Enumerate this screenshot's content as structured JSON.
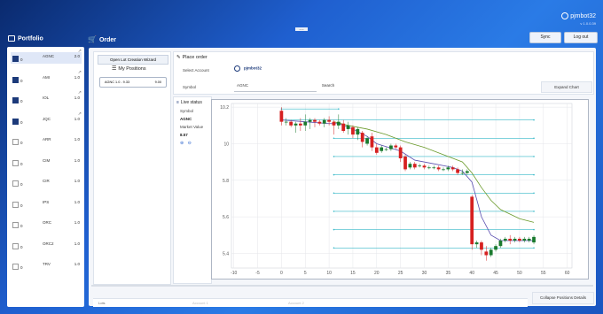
{
  "window": {
    "title_badge": "~~~"
  },
  "user": {
    "name": "pjmbot32",
    "version": "v 1.0.0.39"
  },
  "header": {
    "portfolio_title": "Portfolio",
    "order_title": "Order",
    "sync_label": "Sync",
    "logout_label": "Log out"
  },
  "portfolio": {
    "rows": [
      {
        "checked": true,
        "qty": "0",
        "symbol": "AGNC",
        "value": "2.0",
        "selected": true,
        "marked": true
      },
      {
        "checked": true,
        "qty": "0",
        "symbol": "AMI",
        "value": "1.0",
        "selected": false,
        "marked": true
      },
      {
        "checked": true,
        "qty": "0",
        "symbol": "IOL",
        "value": "1.0",
        "selected": false,
        "marked": true
      },
      {
        "checked": true,
        "qty": "0",
        "symbol": "JQC",
        "value": "1.0",
        "selected": false,
        "marked": true
      },
      {
        "checked": false,
        "qty": "0",
        "symbol": "ARR",
        "value": "1.0",
        "selected": false,
        "marked": false
      },
      {
        "checked": false,
        "qty": "0",
        "symbol": "CIM",
        "value": "1.0",
        "selected": false,
        "marked": false
      },
      {
        "checked": false,
        "qty": "0",
        "symbol": "CIR",
        "value": "1.0",
        "selected": false,
        "marked": false
      },
      {
        "checked": false,
        "qty": "0",
        "symbol": "IPS",
        "value": "1.0",
        "selected": false,
        "marked": false
      },
      {
        "checked": false,
        "qty": "0",
        "symbol": "ORC",
        "value": "1.0",
        "selected": false,
        "marked": false
      },
      {
        "checked": false,
        "qty": "0",
        "symbol": "ORC2",
        "value": "1.0",
        "selected": false,
        "marked": false
      },
      {
        "checked": false,
        "qty": "0",
        "symbol": "TRV",
        "value": "1.0",
        "selected": false,
        "marked": false
      }
    ]
  },
  "positions": {
    "wizard_label": "Open Lot Creation Wizard",
    "title": "My Positions",
    "item_symbol": "AGNC 1.0 - 9.33",
    "item_value": "9.00"
  },
  "place_order": {
    "title": "Place order",
    "account_label": "Select Account",
    "account_name": "pjmbot32",
    "symbol_label": "Symbol",
    "symbol_value": "AGNC",
    "search_label": "Search",
    "expand_label": "Expand Chart"
  },
  "live_status": {
    "title": "Live status",
    "symbol_label": "Symbol",
    "symbol_value": "AGNC",
    "market_value_label": "Market Value",
    "market_value": "8.57"
  },
  "bottom": {
    "collapse_label": "Collapse Positions Details",
    "lots_label": "Lots",
    "account1": "Account 1",
    "account2": "Account 2"
  },
  "colors": {
    "up": "#1a7a2e",
    "down": "#d62020",
    "ma_fast": "#5a4fb0",
    "ma_slow": "#6a9a2a",
    "level": "#35b8c8"
  },
  "chart_data": {
    "type": "candlestick",
    "xticks": [
      -10,
      -5,
      0,
      5,
      10,
      15,
      20,
      25,
      30,
      35,
      40,
      45,
      50,
      55,
      60
    ],
    "yticks": [
      5.4,
      5.6,
      5.8,
      10,
      10.2
    ],
    "ytick_values": [
      9.4,
      9.6,
      9.8,
      10.0,
      10.2
    ],
    "xlim": [
      -10.5,
      61
    ],
    "ylim": [
      9.32,
      10.22
    ],
    "candles": [
      {
        "x": 0,
        "o": 10.18,
        "c": 10.12,
        "h": 10.2,
        "l": 10.1
      },
      {
        "x": 1,
        "o": 10.12,
        "c": 10.12,
        "h": 10.14,
        "l": 10.1
      },
      {
        "x": 2,
        "o": 10.12,
        "c": 10.1,
        "h": 10.13,
        "l": 10.09
      },
      {
        "x": 3,
        "o": 10.1,
        "c": 10.11,
        "h": 10.12,
        "l": 10.06
      },
      {
        "x": 4,
        "o": 10.11,
        "c": 10.1,
        "h": 10.14,
        "l": 10.07
      },
      {
        "x": 5,
        "o": 10.1,
        "c": 10.12,
        "h": 10.16,
        "l": 10.07
      },
      {
        "x": 6,
        "o": 10.12,
        "c": 10.13,
        "h": 10.14,
        "l": 10.08
      },
      {
        "x": 7,
        "o": 10.13,
        "c": 10.12,
        "h": 10.14,
        "l": 10.09
      },
      {
        "x": 8,
        "o": 10.12,
        "c": 10.11,
        "h": 10.13,
        "l": 10.1
      },
      {
        "x": 9,
        "o": 10.11,
        "c": 10.13,
        "h": 10.14,
        "l": 10.09
      },
      {
        "x": 10,
        "o": 10.13,
        "c": 10.12,
        "h": 10.15,
        "l": 10.1
      },
      {
        "x": 11,
        "o": 10.12,
        "c": 10.1,
        "h": 10.13,
        "l": 10.05
      },
      {
        "x": 12,
        "o": 10.1,
        "c": 10.12,
        "h": 10.16,
        "l": 10.08
      },
      {
        "x": 13,
        "o": 10.11,
        "c": 10.07,
        "h": 10.13,
        "l": 10.06
      },
      {
        "x": 14,
        "o": 10.08,
        "c": 10.1,
        "h": 10.12,
        "l": 10.05
      },
      {
        "x": 15,
        "o": 10.09,
        "c": 10.05,
        "h": 10.1,
        "l": 10.03
      },
      {
        "x": 16,
        "o": 10.05,
        "c": 10.08,
        "h": 10.09,
        "l": 10.02
      },
      {
        "x": 17,
        "o": 10.06,
        "c": 10.01,
        "h": 10.07,
        "l": 9.98
      },
      {
        "x": 18,
        "o": 10.0,
        "c": 10.03,
        "h": 10.04,
        "l": 9.99
      },
      {
        "x": 19,
        "o": 10.04,
        "c": 9.98,
        "h": 10.06,
        "l": 9.96
      },
      {
        "x": 20,
        "o": 9.98,
        "c": 9.95,
        "h": 10.0,
        "l": 9.94
      },
      {
        "x": 21,
        "o": 9.96,
        "c": 9.98,
        "h": 9.99,
        "l": 9.95
      },
      {
        "x": 22,
        "o": 9.97,
        "c": 9.97,
        "h": 9.98,
        "l": 9.96
      },
      {
        "x": 23,
        "o": 9.97,
        "c": 9.99,
        "h": 10.0,
        "l": 9.96
      },
      {
        "x": 24,
        "o": 9.99,
        "c": 9.98,
        "h": 10.0,
        "l": 9.97
      },
      {
        "x": 25,
        "o": 9.98,
        "c": 9.92,
        "h": 9.99,
        "l": 9.9
      },
      {
        "x": 26,
        "o": 9.93,
        "c": 9.86,
        "h": 9.94,
        "l": 9.85
      },
      {
        "x": 27,
        "o": 9.87,
        "c": 9.89,
        "h": 9.9,
        "l": 9.86
      },
      {
        "x": 28,
        "o": 9.89,
        "c": 9.87,
        "h": 9.9,
        "l": 9.86
      },
      {
        "x": 29,
        "o": 9.88,
        "c": 9.88,
        "h": 9.89,
        "l": 9.87
      },
      {
        "x": 30,
        "o": 9.88,
        "c": 9.87,
        "h": 9.89,
        "l": 9.86
      },
      {
        "x": 31,
        "o": 9.87,
        "c": 9.87,
        "h": 9.88,
        "l": 9.86
      },
      {
        "x": 32,
        "o": 9.87,
        "c": 9.87,
        "h": 9.88,
        "l": 9.86
      },
      {
        "x": 33,
        "o": 9.87,
        "c": 9.86,
        "h": 9.88,
        "l": 9.85
      },
      {
        "x": 34,
        "o": 9.86,
        "c": 9.86,
        "h": 9.87,
        "l": 9.85
      },
      {
        "x": 35,
        "o": 9.86,
        "c": 9.87,
        "h": 9.88,
        "l": 9.85
      },
      {
        "x": 36,
        "o": 9.87,
        "c": 9.86,
        "h": 9.88,
        "l": 9.85
      },
      {
        "x": 37,
        "o": 9.86,
        "c": 9.84,
        "h": 9.87,
        "l": 9.83
      },
      {
        "x": 38,
        "o": 9.84,
        "c": 9.84,
        "h": 9.86,
        "l": 9.83
      },
      {
        "x": 39,
        "o": 9.84,
        "c": 9.85,
        "h": 9.86,
        "l": 9.83
      },
      {
        "x": 40,
        "o": 9.71,
        "c": 9.45,
        "h": 9.72,
        "l": 9.42
      },
      {
        "x": 41,
        "o": 9.45,
        "c": 9.46,
        "h": 9.47,
        "l": 9.43
      },
      {
        "x": 42,
        "o": 9.46,
        "c": 9.42,
        "h": 9.47,
        "l": 9.39
      },
      {
        "x": 43,
        "o": 9.41,
        "c": 9.39,
        "h": 9.44,
        "l": 9.36
      },
      {
        "x": 44,
        "o": 9.39,
        "c": 9.42,
        "h": 9.43,
        "l": 9.38
      },
      {
        "x": 45,
        "o": 9.42,
        "c": 9.44,
        "h": 9.45,
        "l": 9.41
      },
      {
        "x": 46,
        "o": 9.44,
        "c": 9.47,
        "h": 9.48,
        "l": 9.43
      },
      {
        "x": 47,
        "o": 9.47,
        "c": 9.48,
        "h": 9.49,
        "l": 9.46
      },
      {
        "x": 48,
        "o": 9.48,
        "c": 9.47,
        "h": 9.5,
        "l": 9.45
      },
      {
        "x": 49,
        "o": 9.47,
        "c": 9.48,
        "h": 9.49,
        "l": 9.46
      },
      {
        "x": 50,
        "o": 9.48,
        "c": 9.47,
        "h": 9.49,
        "l": 9.46
      },
      {
        "x": 51,
        "o": 9.47,
        "c": 9.48,
        "h": 9.49,
        "l": 9.46
      },
      {
        "x": 52,
        "o": 9.47,
        "c": 9.48,
        "h": 9.49,
        "l": 9.46
      },
      {
        "x": 53,
        "o": 9.46,
        "c": 9.49,
        "h": 9.5,
        "l": 9.45
      }
    ],
    "ma_fast": [
      [
        0,
        10.13
      ],
      [
        5,
        10.12
      ],
      [
        10,
        10.11
      ],
      [
        12,
        10.11
      ],
      [
        15,
        10.08
      ],
      [
        18,
        10.04
      ],
      [
        20,
        10.0
      ],
      [
        25,
        9.96
      ],
      [
        28,
        9.91
      ],
      [
        32,
        9.89
      ],
      [
        36,
        9.87
      ],
      [
        38,
        9.85
      ],
      [
        40,
        9.79
      ],
      [
        42,
        9.6
      ],
      [
        44,
        9.5
      ],
      [
        46,
        9.47
      ],
      [
        49,
        9.47
      ],
      [
        53,
        9.47
      ]
    ],
    "ma_slow": [
      [
        11,
        10.12
      ],
      [
        14,
        10.1
      ],
      [
        18,
        10.08
      ],
      [
        22,
        10.05
      ],
      [
        26,
        10.01
      ],
      [
        30,
        9.98
      ],
      [
        34,
        9.94
      ],
      [
        38,
        9.9
      ],
      [
        40,
        9.84
      ],
      [
        42,
        9.76
      ],
      [
        44,
        9.69
      ],
      [
        46,
        9.64
      ],
      [
        50,
        9.59
      ],
      [
        53,
        9.57
      ]
    ],
    "levels": [
      {
        "y": 10.19,
        "x0": 0,
        "x1": 12
      },
      {
        "y": 10.13,
        "x0": 0,
        "x1": 53
      },
      {
        "y": 10.03,
        "x0": 11,
        "x1": 53
      },
      {
        "y": 9.93,
        "x0": 11,
        "x1": 53
      },
      {
        "y": 9.83,
        "x0": 11,
        "x1": 53
      },
      {
        "y": 9.73,
        "x0": 11,
        "x1": 53
      },
      {
        "y": 9.63,
        "x0": 11,
        "x1": 53
      },
      {
        "y": 9.53,
        "x0": 11,
        "x1": 53
      },
      {
        "y": 9.43,
        "x0": 11,
        "x1": 53
      }
    ]
  }
}
